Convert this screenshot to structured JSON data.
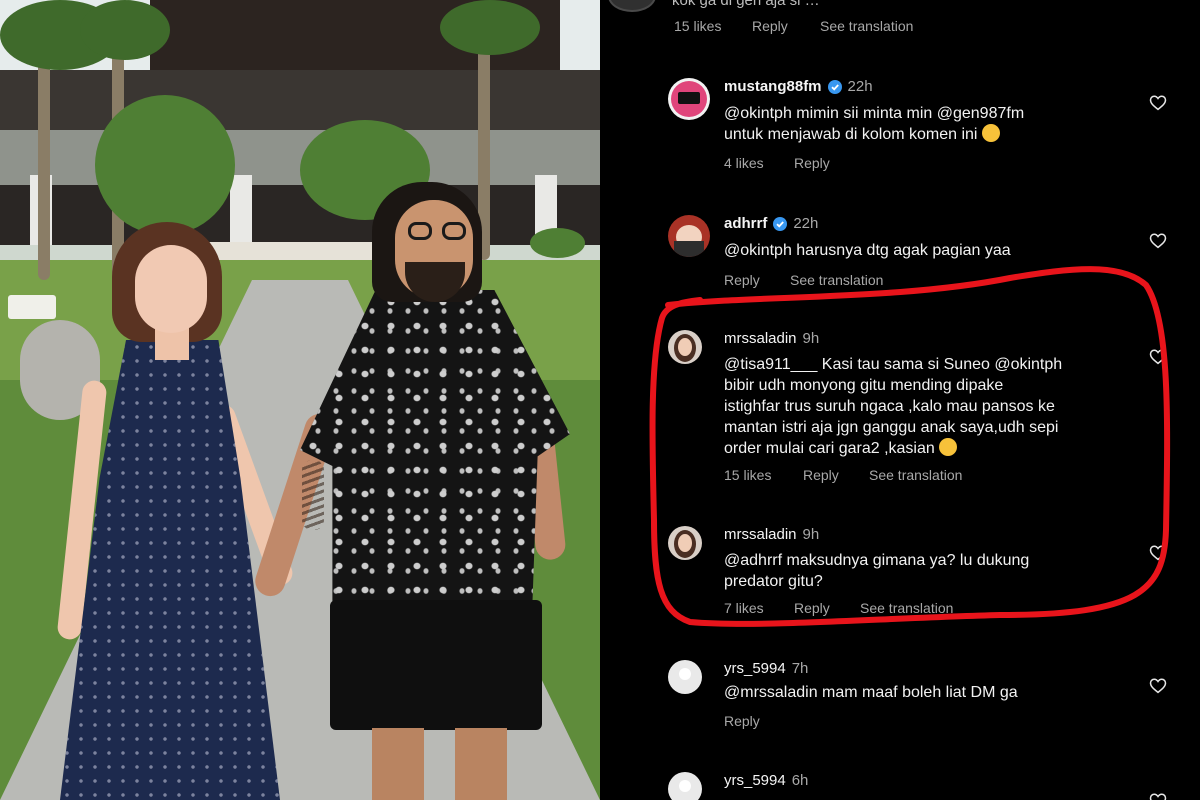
{
  "top_fragment": {
    "text": "kok ga di gen aja si …",
    "likes": "15 likes",
    "reply": "Reply",
    "see_translation": "See translation"
  },
  "comments": [
    {
      "username": "mustang88fm",
      "verified": true,
      "time": "22h",
      "text_lines": [
        "@okintph mimin sii minta min @gen987fm",
        "untuk menjawab di kolom komen ini"
      ],
      "likes": "4 likes",
      "reply": "Reply",
      "see_translation": "",
      "avatar_color": "#e0457b"
    },
    {
      "username": "adhrrf",
      "verified": true,
      "time": "22h",
      "text_lines": [
        "@okintph harusnya dtg agak pagian yaa"
      ],
      "likes": "",
      "reply": "Reply",
      "see_translation": "See translation",
      "avatar_color": "#c0392b"
    },
    {
      "username": "mrssaladin",
      "verified": false,
      "time": "9h",
      "text_lines": [
        "@tisa911___ Kasi tau sama si Suneo @okintph",
        "bibir udh monyong gitu mending dipake",
        "istighfar trus suruh ngaca ,kalo mau pansos ke",
        "mantan istri aja jgn ganggu anak saya,udh sepi",
        "order mulai cari gara2 ,kasian"
      ],
      "likes": "15 likes",
      "reply": "Reply",
      "see_translation": "See translation",
      "avatar_color": "#d9cfc7"
    },
    {
      "username": "mrssaladin",
      "verified": false,
      "time": "9h",
      "text_lines": [
        "@adhrrf maksudnya gimana ya? lu dukung",
        "predator gitu?"
      ],
      "likes": "7 likes",
      "reply": "Reply",
      "see_translation": "See translation",
      "avatar_color": "#d9cfc7"
    },
    {
      "username": "yrs_5994",
      "verified": false,
      "time": "7h",
      "text_lines": [
        "@mrssaladin mam maaf boleh liat DM ga"
      ],
      "likes": "",
      "reply": "Reply",
      "see_translation": "",
      "avatar_color": "#e9e9e9"
    },
    {
      "username": "yrs_5994",
      "verified": false,
      "time": "6h",
      "text_lines": [],
      "likes": "",
      "reply": "",
      "see_translation": "",
      "avatar_color": "#e9e9e9"
    }
  ],
  "colors": {
    "background": "#000000",
    "text": "#f2f2f2",
    "muted": "#a8a8a8",
    "verified": "#3897f0",
    "highlight": "#e8141b"
  },
  "icons": {
    "like": "heart-outline-icon",
    "verified": "verified-badge-icon",
    "emoji_laugh": "face-with-tears-of-joy-emoji",
    "emoji_blush": "smiling-face-emoji"
  }
}
